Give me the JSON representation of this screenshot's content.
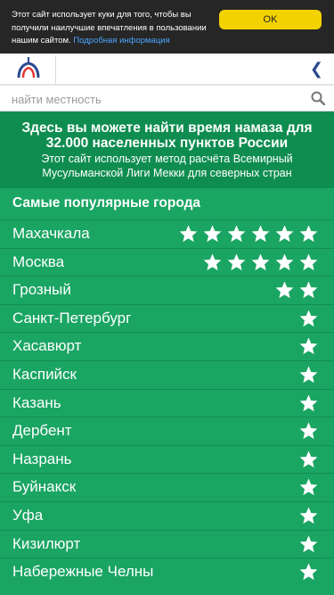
{
  "cookie": {
    "text": "Этот сайт использует куки для того, чтобы вы получили наилучшие впечатления в пользовании нашим сайтом.",
    "link_label": "Подробная информация",
    "ok_label": "OK"
  },
  "topbar": {
    "logo_icon": "mosque-dome-icon",
    "back_icon": "chevron-left-icon"
  },
  "search": {
    "placeholder": "найти местность",
    "icon": "search-icon"
  },
  "intro": {
    "title": "Здесь вы можете найти время намаза для 32.000 населенных пунктов России",
    "subtitle": "Этот сайт использует метод расчёта Всемирный Мусульманской Лиги Мекки для северных стран"
  },
  "popular": {
    "title": "Самые популярные города"
  },
  "colors": {
    "green": "#1aa563",
    "dark_green": "#0f8d50",
    "cookie_bg": "#262626",
    "ok_yellow": "#f2d200",
    "link_blue": "#4ba6ff"
  },
  "cities": [
    {
      "name": "Махачкала",
      "stars": 6
    },
    {
      "name": "Москва",
      "stars": 5
    },
    {
      "name": "Грозный",
      "stars": 2
    },
    {
      "name": "Санкт-Петербург",
      "stars": 1
    },
    {
      "name": "Хасавюрт",
      "stars": 1
    },
    {
      "name": "Каспийск",
      "stars": 1
    },
    {
      "name": "Казань",
      "stars": 1
    },
    {
      "name": "Дербент",
      "stars": 1
    },
    {
      "name": "Назрань",
      "stars": 1
    },
    {
      "name": "Буйнакск",
      "stars": 1
    },
    {
      "name": "Уфа",
      "stars": 1
    },
    {
      "name": "Кизилюрт",
      "stars": 1
    },
    {
      "name": "Набережные Челны",
      "stars": 1
    }
  ]
}
